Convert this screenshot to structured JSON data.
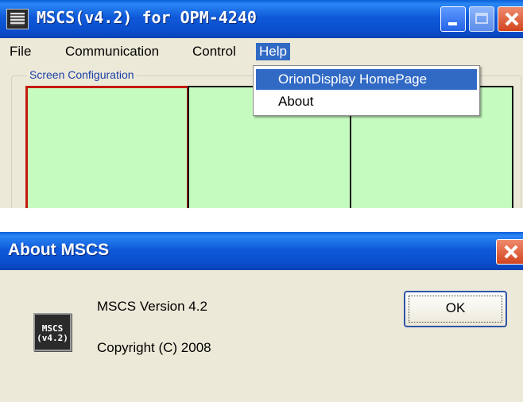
{
  "main_window": {
    "title": "MSCS(v4.2) for OPM-4240",
    "menu": [
      "File",
      "Communication",
      "Control",
      "Help"
    ],
    "active_menu": "Help",
    "group_label": "Screen Configuration",
    "help_menu": {
      "items": [
        "OrionDisplay HomePage",
        "About"
      ],
      "highlighted": "OrionDisplay HomePage"
    },
    "pane_color": "#c6fbc0",
    "selected_border_color": "#c41a0c"
  },
  "about_dialog": {
    "title": "About MSCS",
    "logo_line1": "MSCS",
    "logo_line2": "(v4.2)",
    "version_text": "MSCS Version 4.2",
    "copyright_text": "Copyright (C) 2008",
    "ok_label": "OK"
  },
  "colors": {
    "titlebar": "#0a5fd8",
    "highlight": "#316ac5",
    "face": "#ece9d8"
  }
}
